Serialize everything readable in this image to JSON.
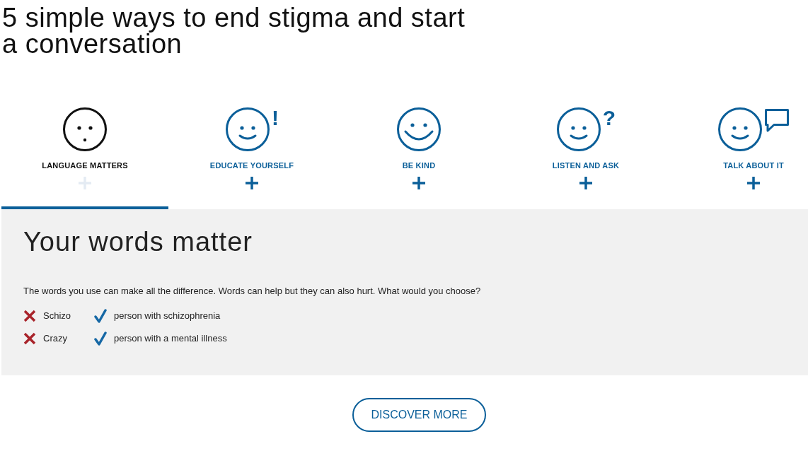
{
  "title": "5 simple ways to end stigma and start a conversation",
  "tabs": [
    {
      "label": "LANGUAGE MATTERS",
      "kind": "neutral",
      "selected": true
    },
    {
      "label": "EDUCATE YOURSELF",
      "kind": "smile",
      "badge": "!",
      "selected": false
    },
    {
      "label": "BE KIND",
      "kind": "grin",
      "selected": false
    },
    {
      "label": "LISTEN AND ASK",
      "kind": "smile",
      "badge": "?",
      "selected": false
    },
    {
      "label": "TALK ABOUT IT",
      "kind": "talk",
      "selected": false
    }
  ],
  "panel": {
    "heading": "Your words matter",
    "text": "The words you use can make all the difference. Words can help but they can also hurt. What would you choose?",
    "pairs": [
      {
        "avoid": "Schizo",
        "prefer": "person with schizophrenia"
      },
      {
        "avoid": "Crazy",
        "prefer": "person with a mental illness"
      }
    ]
  },
  "button": "DISCOVER MORE"
}
